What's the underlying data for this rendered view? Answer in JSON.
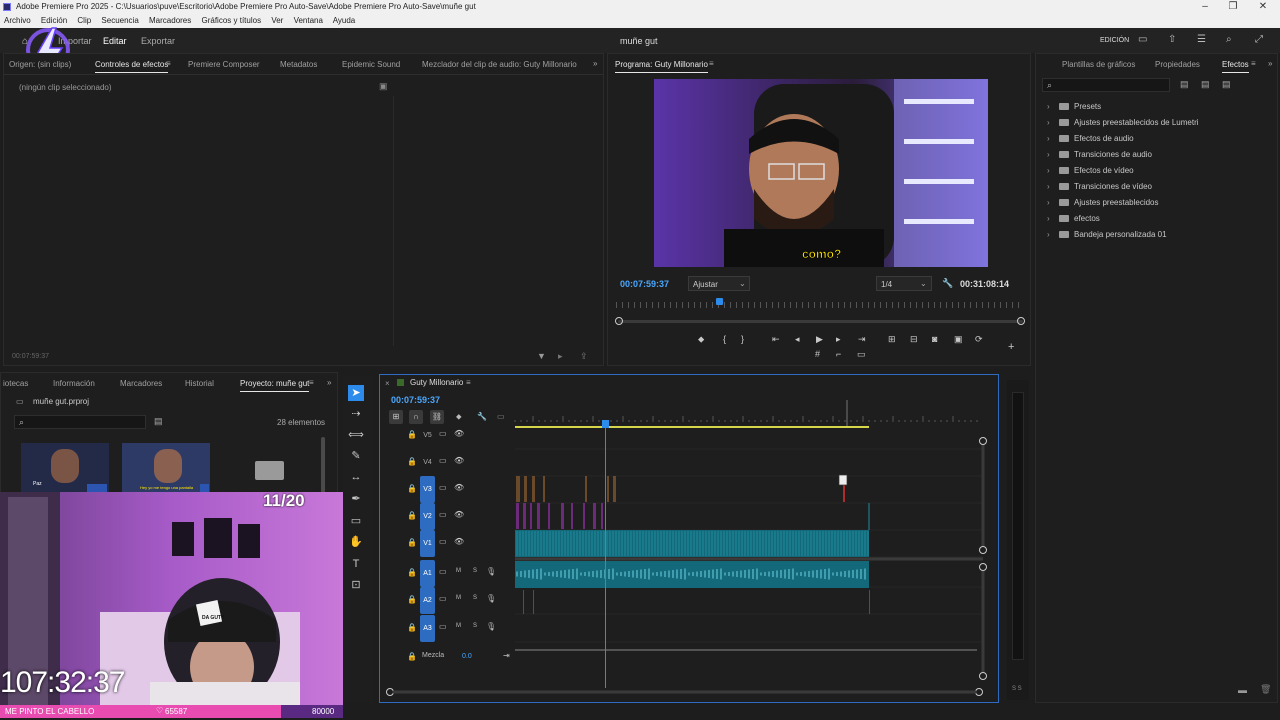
{
  "window": {
    "title": "Adobe Premiere Pro 2025 - C:\\Usuarios\\puve\\Escritorio\\Adobe Premiere Pro Auto-Save\\Adobe Premiere Pro Auto-Save\\muñe gut",
    "min": "–",
    "max": "❐",
    "close": "✕"
  },
  "menu": [
    "Archivo",
    "Edición",
    "Clip",
    "Secuencia",
    "Marcadores",
    "Gráficos y títulos",
    "Ver",
    "Ventana",
    "Ayuda"
  ],
  "header": {
    "import": "Importar",
    "edit": "Editar",
    "export": "Exportar",
    "project_name": "muñe gut",
    "workspace": "EDICIÓN"
  },
  "source_panel": {
    "tabs": [
      "Origen: (sin clips)",
      "Controles de efectos",
      "Premiere Composer",
      "Metadatos",
      "Epidemic Sound",
      "Mezclador del clip de audio: Guty Millonario"
    ],
    "empty_text": "(ningún clip seleccionado)",
    "timecode": "00:07:59:37"
  },
  "program_monitor": {
    "title": "Programa: Guty Millonario",
    "caption": "como?",
    "timecode": "00:07:59:37",
    "fit": "Ajustar",
    "resolution": "1/4",
    "duration": "00:31:08:14"
  },
  "effects_panel": {
    "tabs": [
      "Plantillas de gráficos",
      "Propiedades",
      "Efectos"
    ],
    "items": [
      "Presets",
      "Ajustes preestablecidos de Lumetri",
      "Efectos de audio",
      "Transiciones de audio",
      "Efectos de vídeo",
      "Transiciones de vídeo",
      "Ajustes preestablecidos",
      "efectos",
      "Bandeja personalizada 01"
    ]
  },
  "project_panel": {
    "tabs": [
      "iotecas",
      "Información",
      "Marcadores",
      "Historial",
      "Proyecto: muñe gut"
    ],
    "file": "muñe gut.prproj",
    "count": "28 elementos",
    "thumb_captions": [
      "Paz",
      "Hey yo me tengo una pantalla"
    ]
  },
  "timeline": {
    "sequence": "Guty Millonario",
    "timecode": "00:07:59:37",
    "tracks": [
      {
        "name": "V5",
        "type": "video"
      },
      {
        "name": "V4",
        "type": "video"
      },
      {
        "name": "V3",
        "type": "video"
      },
      {
        "name": "V2",
        "type": "video"
      },
      {
        "name": "V1",
        "type": "video"
      },
      {
        "name": "A1",
        "type": "audio"
      },
      {
        "name": "A2",
        "type": "audio"
      },
      {
        "name": "A3",
        "type": "audio"
      }
    ],
    "mix_label": "Mezcla",
    "mix_value": "0.0",
    "m_label": "M",
    "s_label": "S"
  },
  "stream_overlay": {
    "counter": "11/20",
    "clock": "107:32:37",
    "ticker_text": "ME PINTO EL CABELLO",
    "ticker_value": "65587",
    "ticker_goal": "80000",
    "cap_text": "DA GUTY"
  },
  "meter": {
    "label": "S S"
  },
  "colors": {
    "accent": "#2d8ceb",
    "panel": "#1e1e1e",
    "clip_video": "#13697a",
    "ticker": "#e84cb0"
  }
}
